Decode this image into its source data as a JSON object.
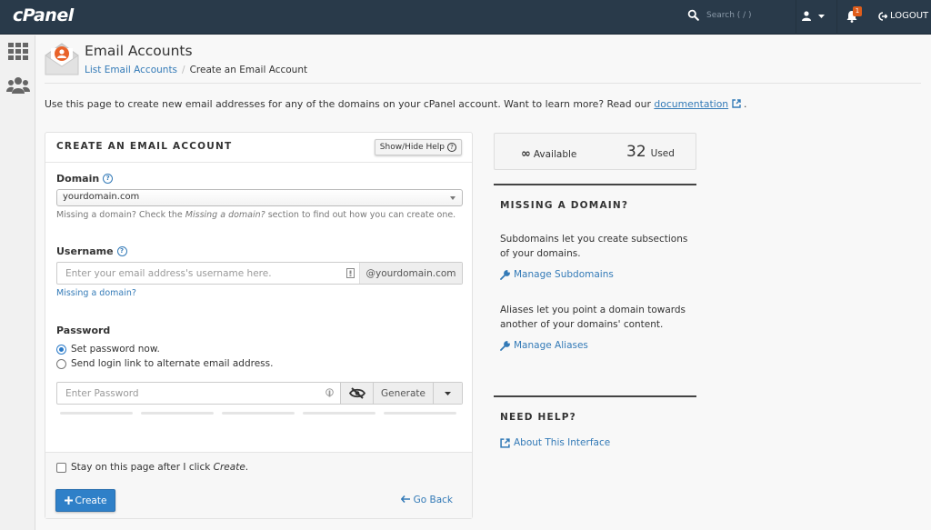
{
  "topbar": {
    "logo": "cPanel",
    "search_placeholder": "Search ( / )",
    "notification_count": "1",
    "logout_label": "LOGOUT"
  },
  "leftnav": {
    "items": [
      {
        "icon": "grid-icon",
        "label": "Tools"
      },
      {
        "icon": "users-icon",
        "label": "Users"
      }
    ]
  },
  "header": {
    "title": "Email Accounts",
    "breadcrumb": [
      {
        "label": "List Email Accounts",
        "link": true
      },
      {
        "label": "Create an Email Account",
        "link": false
      }
    ],
    "separator": "/"
  },
  "intro": {
    "text": "Use this page to create new email addresses for any of the domains on your cPanel account. Want to learn more? Read our ",
    "link": "documentation",
    "after": "."
  },
  "form": {
    "title": "CREATE AN EMAIL ACCOUNT",
    "help_button": "Show/Hide Help",
    "domain": {
      "label": "Domain",
      "value": "yourdomain.com",
      "hint_pre": "Missing a domain? Check the ",
      "hint_em": "Missing a domain?",
      "hint_post": " section to find out how you can create one."
    },
    "username": {
      "label": "Username",
      "placeholder": "Enter your email address's username here.",
      "value": "",
      "suffix": "@yourdomain.com",
      "missing_link": "Missing a domain?"
    },
    "password": {
      "label": "Password",
      "options": [
        {
          "label": "Set password now.",
          "selected": true
        },
        {
          "label": "Send login link to alternate email address.",
          "selected": false
        }
      ],
      "placeholder": "Enter Password",
      "value": "",
      "generate_label": "Generate",
      "strength_segments": 5,
      "strength_filled": 0
    },
    "stay_checkbox": {
      "label_pre": "Stay on this page after I click ",
      "label_em": "Create",
      "label_post": ".",
      "checked": false
    },
    "create_label": "Create",
    "goback_label": "Go Back"
  },
  "sidebar": {
    "available_symbol": "∞",
    "available_label": "Available",
    "used_count": "32",
    "used_label": "Used",
    "missing_domain": {
      "heading": "MISSING A DOMAIN?",
      "subdomains_text": "Subdomains let you create subsections of your domains.",
      "subdomains_link": "Manage Subdomains",
      "aliases_text": "Aliases let you point a domain towards another of your domains' content.",
      "aliases_link": "Manage Aliases"
    },
    "need_help": {
      "heading": "NEED HELP?",
      "link": "About This Interface"
    }
  },
  "colors": {
    "topbar": "#293a4a",
    "accent": "#2f80c8",
    "link": "#337ab7",
    "badge": "#e05d1b",
    "brand_orange": "#e9632a"
  }
}
